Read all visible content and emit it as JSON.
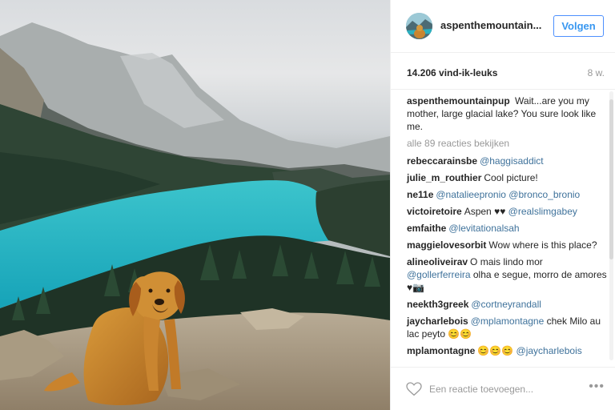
{
  "post": {
    "photo_alt": "golden retriever overlooking glacial lake",
    "username": "aspenthemountain...",
    "follow_label": "Volgen",
    "likes": "14.206 vind-ik-leuks",
    "time_ago": "8 w.",
    "caption": {
      "user": "aspenthemountainpup",
      "text": "Wait...are you my mother, large glacial lake? You sure look like me."
    },
    "view_all": "alle 89 reacties bekijken",
    "comments": [
      {
        "user": "rebeccarainsbe",
        "parts": [
          {
            "t": "@haggisaddict",
            "m": true
          }
        ]
      },
      {
        "user": "julie_m_routhier",
        "parts": [
          {
            "t": "Cool picture!",
            "m": false
          }
        ]
      },
      {
        "user": "ne11e",
        "parts": [
          {
            "t": "@natalieepronio",
            "m": true
          },
          {
            "t": " ",
            "m": false
          },
          {
            "t": "@bronco_bronio",
            "m": true
          }
        ]
      },
      {
        "user": "victoiretoire",
        "parts": [
          {
            "t": "Aspen ♥♥ ",
            "m": false
          },
          {
            "t": "@realslimgabey",
            "m": true
          }
        ]
      },
      {
        "user": "emfaithe",
        "parts": [
          {
            "t": "@levitationalsah",
            "m": true
          }
        ]
      },
      {
        "user": "maggielovesorbit",
        "parts": [
          {
            "t": "Wow where is this place?",
            "m": false
          }
        ]
      },
      {
        "user": "alineoliveirav",
        "parts": [
          {
            "t": "O mais lindo mor ",
            "m": false
          },
          {
            "t": "@gollerferreira",
            "m": true
          },
          {
            "t": " olha e segue, morro de amores ♥📷",
            "m": false
          }
        ]
      },
      {
        "user": "neekth3greek",
        "parts": [
          {
            "t": "@cortneyrandall",
            "m": true
          }
        ]
      },
      {
        "user": "jaycharlebois",
        "parts": [
          {
            "t": "@mplamontagne",
            "m": true
          },
          {
            "t": " chek Milo au lac peyto 😊😊",
            "m": false
          }
        ]
      },
      {
        "user": "mplamontagne",
        "parts": [
          {
            "t": "😊😊😊 ",
            "m": false
          },
          {
            "t": "@jaycharlebois",
            "m": true
          }
        ]
      }
    ],
    "comment_placeholder": "Een reactie toevoegen...",
    "more_label": "•••"
  },
  "colors": {
    "follow_blue": "#3897f0",
    "mention_blue": "#3f729b",
    "lake_turquoise": "#22b5c4"
  }
}
